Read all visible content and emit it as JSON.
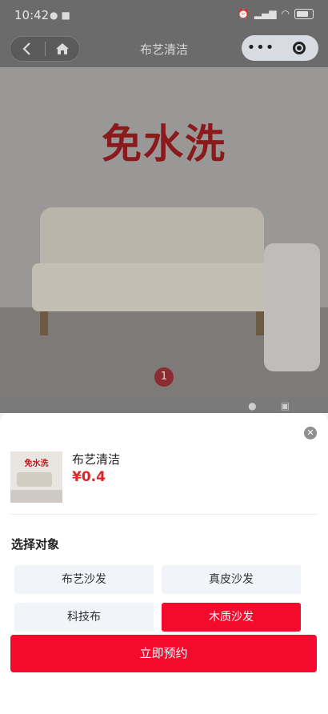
{
  "status_bar": {
    "time": "10:42",
    "left_icons": [
      "chat-icon",
      "image-icon"
    ],
    "right_icons": [
      "alarm-icon",
      "hd-icon",
      "signal-icon",
      "wifi-icon",
      "battery-icon"
    ]
  },
  "nav": {
    "title": "布艺清洁",
    "left_buttons": [
      "back-icon",
      "home-icon"
    ],
    "right_buttons": [
      "more-icon",
      "target-icon"
    ]
  },
  "hero": {
    "slogan": "免水洗",
    "pager": "1"
  },
  "sheet": {
    "product": {
      "name": "布艺清洁",
      "price": "¥0.4",
      "thumb_slogan": "免水洗"
    },
    "section_title": "选择对象",
    "options": [
      {
        "label": "布艺沙发",
        "selected": false
      },
      {
        "label": "真皮沙发",
        "selected": false
      },
      {
        "label": "科技布",
        "selected": false
      },
      {
        "label": "木质沙发",
        "selected": true
      }
    ],
    "cta_label": "立即预约"
  },
  "colors": {
    "accent": "#f40a2c",
    "price": "#e02428",
    "option_bg": "#f1f4f8"
  }
}
